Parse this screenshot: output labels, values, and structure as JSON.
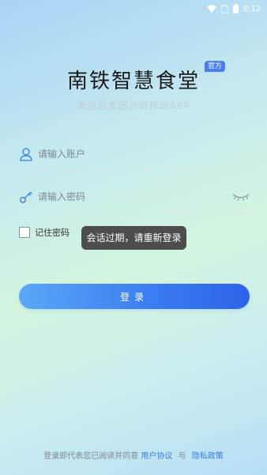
{
  "status_bar": {
    "time": "8:12",
    "icons": [
      "wifi-icon",
      "sim-icon",
      "battery-icon"
    ]
  },
  "header": {
    "title": "南铁智慧食堂",
    "badge": "官方",
    "subtitle": "南昌局集团公司移动APP"
  },
  "form": {
    "account_placeholder": "请输入账户",
    "password_placeholder": "请输入密码",
    "remember_label": "记住密码",
    "remember_checked": false,
    "login_label": "登录"
  },
  "toast": {
    "message": "会话过期，请重新登录"
  },
  "agreement": {
    "prefix": "登录即代表您已阅读并同意",
    "user_agreement": "用户协议",
    "conjunction": "与",
    "privacy_policy": "隐私政策"
  },
  "colors": {
    "accent": "#3b78e7",
    "button_start": "#5ba7f7",
    "button_end": "#2d63e9",
    "badge": "#4a7ef0"
  }
}
